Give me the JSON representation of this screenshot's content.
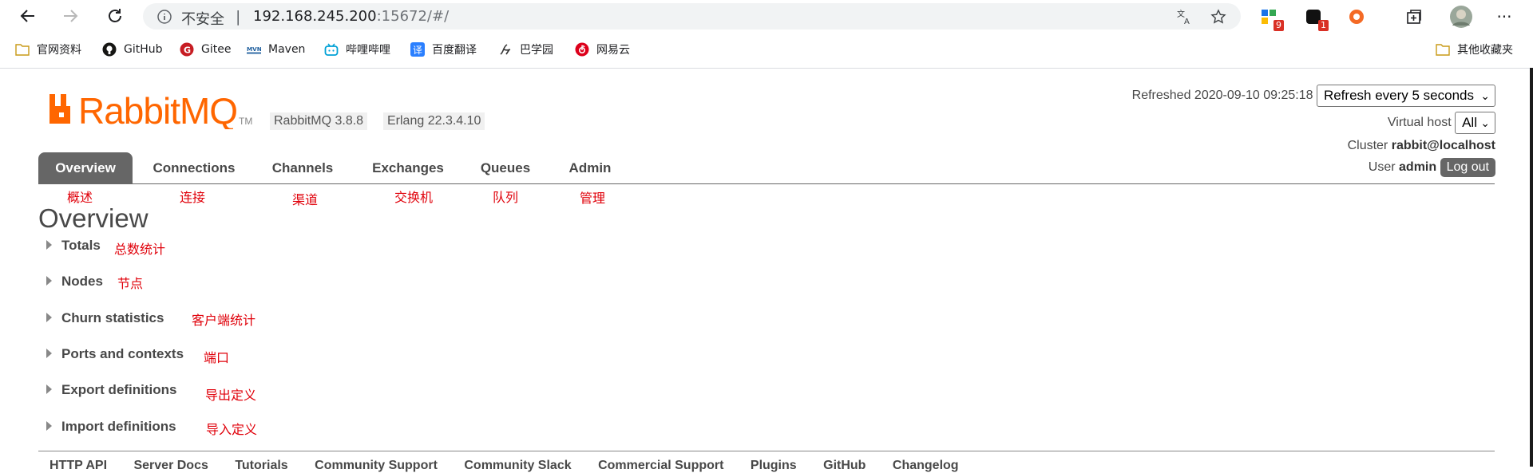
{
  "browser": {
    "address": {
      "security_label": "不安全",
      "separator": "|",
      "url_host": "192.168.245.200",
      "url_rest": ":15672/#/"
    },
    "extensions": [
      {
        "name": "extension-grid",
        "badge": "9"
      },
      {
        "name": "extension-dark",
        "badge": "1"
      },
      {
        "name": "extension-orange",
        "badge": ""
      }
    ],
    "menu_label": "···",
    "bookmarks": [
      {
        "label": "官网资料",
        "icon": "folder-icon"
      },
      {
        "label": "GitHub",
        "icon": "github-icon"
      },
      {
        "label": "Gitee",
        "icon": "gitee-icon"
      },
      {
        "label": "Maven",
        "icon": "maven-icon"
      },
      {
        "label": "哔哩哔哩",
        "icon": "bilibili-icon"
      },
      {
        "label": "百度翻译",
        "icon": "translate-icon"
      },
      {
        "label": "巴学园",
        "icon": "baxueyuan-icon"
      },
      {
        "label": "网易云",
        "icon": "netease-music-icon"
      }
    ],
    "other_bookmarks": "其他收藏夹",
    "colors": {
      "insecure_badge": "#d93025",
      "folder": "#f5c342"
    }
  },
  "app": {
    "logo_text": "RabbitMQ",
    "logo_tm": "TM",
    "version": "RabbitMQ 3.8.8",
    "erlang": "Erlang 22.3.4.10",
    "refreshed_label": "Refreshed 2020-09-10 09:25:18",
    "refresh_select": "Refresh every 5 seconds",
    "vhost_label": "Virtual host",
    "vhost_value": "All",
    "cluster_label": "Cluster",
    "cluster_value": "rabbit@localhost",
    "user_label": "User",
    "user_value": "admin",
    "logout_label": "Log out",
    "colors": {
      "brand_orange": "#f60",
      "tab_active": "#666666",
      "annotation": "#e0000a"
    }
  },
  "tabs": [
    {
      "label": "Overview",
      "active": true,
      "note": "概述"
    },
    {
      "label": "Connections",
      "active": false,
      "note": "连接"
    },
    {
      "label": "Channels",
      "active": false,
      "note": "渠道"
    },
    {
      "label": "Exchanges",
      "active": false,
      "note": "交换机"
    },
    {
      "label": "Queues",
      "active": false,
      "note": "队列"
    },
    {
      "label": "Admin",
      "active": false,
      "note": "管理"
    }
  ],
  "page_title": "Overview",
  "sections": [
    {
      "label": "Totals",
      "note": "总数统计"
    },
    {
      "label": "Nodes",
      "note": "节点"
    },
    {
      "label": "Churn statistics",
      "note": "客户端统计"
    },
    {
      "label": "Ports and contexts",
      "note": "端口"
    },
    {
      "label": "Export definitions",
      "note": "导出定义"
    },
    {
      "label": "Import definitions",
      "note": "导入定义"
    }
  ],
  "footer_links": [
    "HTTP API",
    "Server Docs",
    "Tutorials",
    "Community Support",
    "Community Slack",
    "Commercial Support",
    "Plugins",
    "GitHub",
    "Changelog"
  ]
}
